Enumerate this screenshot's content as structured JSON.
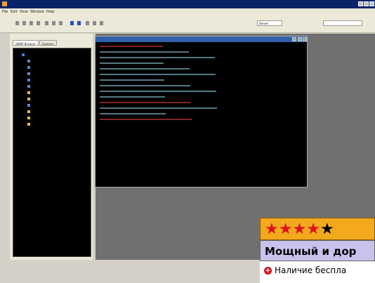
{
  "window": {
    "title": ""
  },
  "menu": {
    "items": [
      "File",
      "Edit",
      "View",
      "Window",
      "Help"
    ]
  },
  "toolbar": {
    "combo_label": "Server"
  },
  "left_panel": {
    "tabs": [
      "SNMP Browser",
      "Explorer"
    ]
  },
  "tree": {
    "items": [
      {
        "label": "",
        "color": "#4a7ac8"
      },
      {
        "label": "",
        "color": "#5a8ad0"
      },
      {
        "label": "",
        "color": "#5a8ad0"
      },
      {
        "label": "",
        "color": "#5a8ad0"
      },
      {
        "label": "",
        "color": "#5a8ad0"
      },
      {
        "label": "",
        "color": "#5a8ad0"
      },
      {
        "label": "",
        "color": "#e0c040"
      },
      {
        "label": "",
        "color": "#e0c040"
      },
      {
        "label": "",
        "color": "#5a8ad0"
      },
      {
        "label": "",
        "color": "#e0c040"
      },
      {
        "label": "",
        "color": "#e0c040"
      },
      {
        "label": "",
        "color": "#e0c040"
      }
    ]
  },
  "console": {
    "title": "",
    "line_colors": [
      "#b33",
      "#7ab",
      "#7ab",
      "#7ab",
      "#7ab",
      "#7ab",
      "#7ab",
      "#7ab",
      "#7ab",
      "#7ab",
      "#b33",
      "#7ab",
      "#7ab",
      "#b33"
    ]
  },
  "review": {
    "rating": 4,
    "max_rating": 5,
    "star_glyph": "★",
    "headline": "Мощный и дор",
    "pro": "Наличие беспла",
    "colors": {
      "stars_bg": "#f2a91c",
      "star_on": "#e0101c",
      "headline_bg": "#c9c2ec",
      "plus": "#d0121c"
    }
  }
}
